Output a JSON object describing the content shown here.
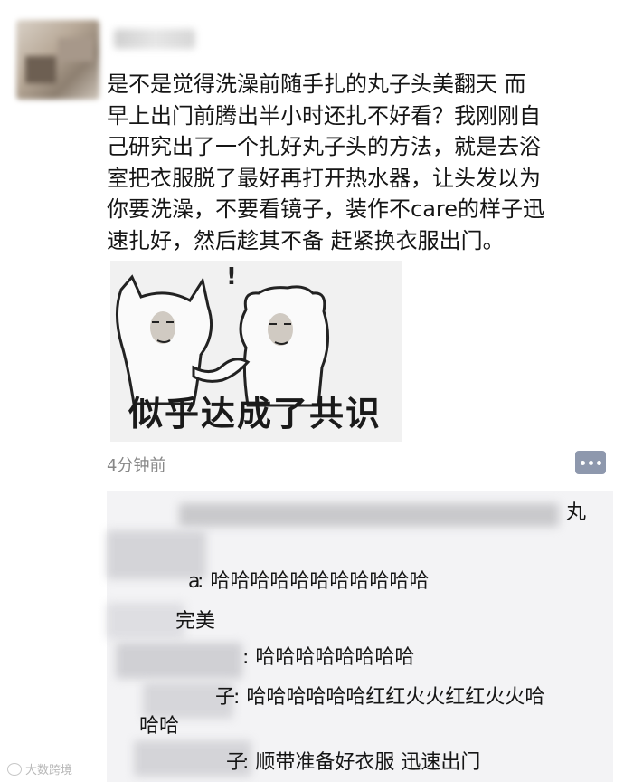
{
  "post": {
    "text": "是不是觉得洗澡前随手扎的丸子头美翻天 而\n早上出门前腾出半小时还扎不好看？我刚刚自\n己研究出了一个扎好丸子头的方法，就是去浴\n室把衣服脱了最好再打开热水器，让头发以为\n你要洗澡，不要看镜子，装作不care的样子迅\n速扎好，然后趁其不备 赶紧换衣服出门。",
    "sticker_caption": "似乎达成了共识",
    "sticker_exclaim": "!",
    "time": "4分钟前"
  },
  "comments": [
    {
      "name_visible": "丸",
      "text": ""
    },
    {
      "name_visible": "a",
      "text": ": 哈哈哈哈哈哈哈哈哈哈哈"
    },
    {
      "name_visible": "",
      "text": "完美"
    },
    {
      "name_visible": "",
      "text": ": 哈哈哈哈哈哈哈哈"
    },
    {
      "name_visible": "子",
      "text": ": 哈哈哈哈哈哈红红火火红红火火哈"
    },
    {
      "name_visible": "",
      "text": "哈哈"
    },
    {
      "name_visible": "子",
      "text": ": 顺带准备好衣服 迅速出门"
    }
  ],
  "watermark": "大数跨境",
  "icons": {
    "avatar": "avatar-blurred",
    "comment": "comment-dots-icon",
    "watermark_logo": "weibo-icon"
  },
  "colors": {
    "comment_bg": "#f3f3f5",
    "comment_button": "#8e98ad",
    "time": "#888888"
  }
}
